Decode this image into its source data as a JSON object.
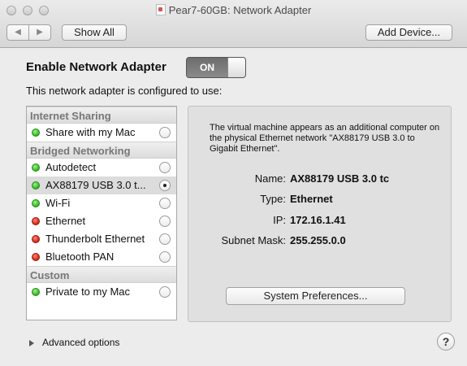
{
  "window": {
    "title": "Pear7-60GB: Network Adapter",
    "toolbar": {
      "back_icon": "chevron-left-icon",
      "forward_icon": "chevron-right-icon",
      "show_all_label": "Show All",
      "add_device_label": "Add Device..."
    }
  },
  "adapter": {
    "heading": "Enable Network Adapter",
    "toggle_label": "ON",
    "subtitle": "This network adapter is configured to use:"
  },
  "list": {
    "sections": [
      {
        "title": "Internet Sharing",
        "items": [
          {
            "label": "Share with my Mac",
            "status": "green",
            "selected": false
          }
        ]
      },
      {
        "title": "Bridged Networking",
        "items": [
          {
            "label": "Autodetect",
            "status": "green",
            "selected": false
          },
          {
            "label": "AX88179 USB 3.0 t...",
            "status": "green",
            "selected": true
          },
          {
            "label": "Wi-Fi",
            "status": "green",
            "selected": false
          },
          {
            "label": "Ethernet",
            "status": "red",
            "selected": false
          },
          {
            "label": "Thunderbolt Ethernet",
            "status": "red",
            "selected": false
          },
          {
            "label": "Bluetooth PAN",
            "status": "red",
            "selected": false
          }
        ]
      },
      {
        "title": "Custom",
        "items": [
          {
            "label": "Private to my Mac",
            "status": "green",
            "selected": false
          }
        ]
      }
    ]
  },
  "details": {
    "description": "The virtual machine appears as an additional computer on the physical Ethernet network \"AX88179 USB 3.0 to Gigabit Ethernet\".",
    "name_label": "Name:",
    "name_value": "AX88179 USB 3.0 tc",
    "type_label": "Type:",
    "type_value": "Ethernet",
    "ip_label": "IP:",
    "ip_value": "172.16.1.41",
    "mask_label": "Subnet Mask:",
    "mask_value": "255.255.0.0",
    "system_prefs_label": "System Preferences..."
  },
  "footer": {
    "advanced_label": "Advanced options",
    "help_label": "?"
  },
  "colors": {
    "status_green": "#2bb31b",
    "status_red": "#d42010"
  }
}
